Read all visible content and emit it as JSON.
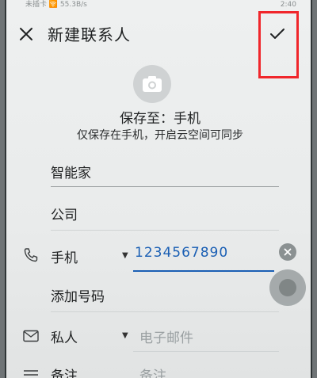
{
  "status_bar": {
    "left": "未插卡 🛜 55.3B/s",
    "right": "2:40"
  },
  "header": {
    "title": "新建联系人",
    "close_icon": "close-icon",
    "confirm_icon": "check-icon",
    "highlight_color": "#f0262b"
  },
  "photo": {
    "icon": "camera-icon"
  },
  "save_location": {
    "label": "保存至：手机",
    "note": "仅保存在手机，开启云空间可同步"
  },
  "fields": {
    "name": "智能家",
    "company": "公司",
    "phone": {
      "type": "手机",
      "value": "1234567890"
    },
    "add_number": "添加号码",
    "email": {
      "type": "私人",
      "placeholder": "电子邮件"
    },
    "notes": {
      "type": "备注",
      "placeholder": "备注"
    }
  },
  "colors": {
    "accent_blue": "#1a5fb4",
    "highlight_red": "#f0262b"
  }
}
